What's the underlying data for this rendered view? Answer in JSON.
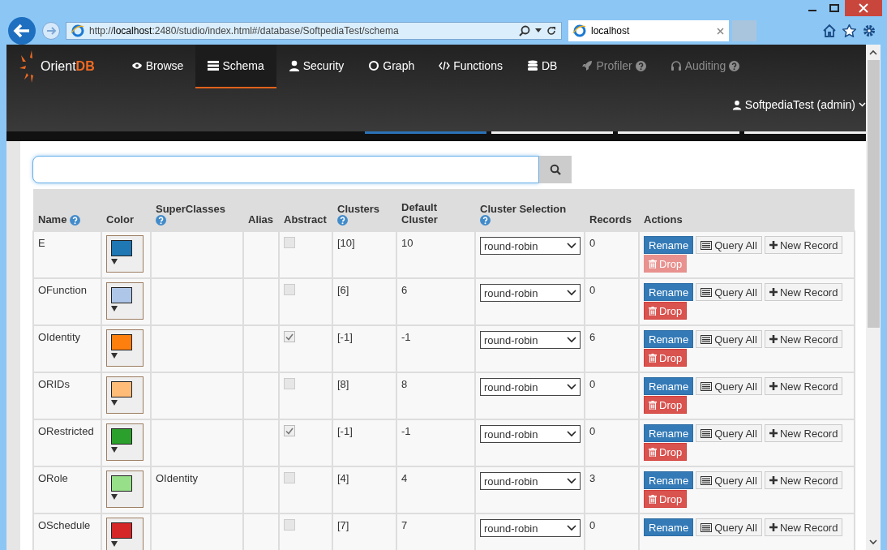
{
  "browser": {
    "url_prefix": "http://",
    "url_host": "localhost",
    "url_rest": ":2480/studio/index.html#/database/SoftpediaTest/schema",
    "tab_title": "localhost"
  },
  "app": {
    "logo": {
      "main": "Orient",
      "accent": "DB"
    },
    "nav": [
      {
        "label": "Browse",
        "selected": false,
        "disabled": false,
        "help": false
      },
      {
        "label": "Schema",
        "selected": true,
        "disabled": false,
        "help": false
      },
      {
        "label": "Security",
        "selected": false,
        "disabled": false,
        "help": false
      },
      {
        "label": "Graph",
        "selected": false,
        "disabled": false,
        "help": false
      },
      {
        "label": "Functions",
        "selected": false,
        "disabled": false,
        "help": false
      },
      {
        "label": "DB",
        "selected": false,
        "disabled": false,
        "help": false
      },
      {
        "label": "Profiler",
        "selected": false,
        "disabled": true,
        "help": true
      },
      {
        "label": "Auditing",
        "selected": false,
        "disabled": true,
        "help": true
      }
    ],
    "user": "SoftpediaTest (admin)"
  },
  "table": {
    "columns": [
      {
        "label": "Name",
        "help": true
      },
      {
        "label": "Color",
        "help": false
      },
      {
        "label": "SuperClasses",
        "help": true
      },
      {
        "label": "Alias",
        "help": false
      },
      {
        "label": "Abstract",
        "help": false
      },
      {
        "label": "Clusters",
        "help": true
      },
      {
        "label": "Default Cluster",
        "help": false
      },
      {
        "label": "Cluster Selection",
        "help": true
      },
      {
        "label": "Records",
        "help": false
      },
      {
        "label": "Actions",
        "help": false
      }
    ],
    "rows": [
      {
        "name": "E",
        "color": "#1f77b4",
        "superclasses": "",
        "abstract": false,
        "clusters": "[10]",
        "default_cluster": "10",
        "cluster_selection": "round-robin",
        "records": "0",
        "actions": [
          "Rename",
          "Query All",
          "New Record",
          "Drop"
        ],
        "drop_disabled": true
      },
      {
        "name": "OFunction",
        "color": "#aec7e8",
        "superclasses": "",
        "abstract": false,
        "clusters": "[6]",
        "default_cluster": "6",
        "cluster_selection": "round-robin",
        "records": "0",
        "actions": [
          "Rename",
          "Query All",
          "New Record",
          "Drop"
        ],
        "drop_disabled": false
      },
      {
        "name": "OIdentity",
        "color": "#ff7f0e",
        "superclasses": "",
        "abstract": true,
        "clusters": "[-1]",
        "default_cluster": "-1",
        "cluster_selection": "round-robin",
        "records": "6",
        "actions": [
          "Rename",
          "Query All",
          "New Record",
          "Drop"
        ],
        "drop_disabled": false
      },
      {
        "name": "ORIDs",
        "color": "#ffbb78",
        "superclasses": "",
        "abstract": false,
        "clusters": "[8]",
        "default_cluster": "8",
        "cluster_selection": "round-robin",
        "records": "0",
        "actions": [
          "Rename",
          "Query All",
          "New Record",
          "Drop"
        ],
        "drop_disabled": false
      },
      {
        "name": "ORestricted",
        "color": "#2ca02c",
        "superclasses": "",
        "abstract": true,
        "clusters": "[-1]",
        "default_cluster": "-1",
        "cluster_selection": "round-robin",
        "records": "0",
        "actions": [
          "Rename",
          "Query All",
          "New Record",
          "Drop"
        ],
        "drop_disabled": false
      },
      {
        "name": "ORole",
        "color": "#98df8a",
        "superclasses": "OIdentity",
        "abstract": false,
        "clusters": "[4]",
        "default_cluster": "4",
        "cluster_selection": "round-robin",
        "records": "3",
        "actions": [
          "Rename",
          "Query All",
          "New Record",
          "Drop"
        ],
        "drop_disabled": false
      },
      {
        "name": "OSchedule",
        "color": "#d62728",
        "superclasses": "",
        "abstract": false,
        "clusters": "[7]",
        "default_cluster": "7",
        "cluster_selection": "round-robin",
        "records": "0",
        "actions": [
          "Rename",
          "Query All",
          "New Record"
        ]
      }
    ]
  }
}
